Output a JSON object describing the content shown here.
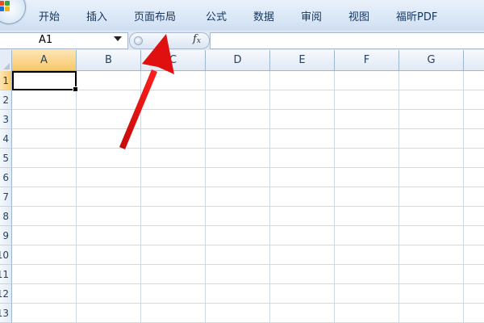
{
  "ribbon": {
    "tabs": [
      {
        "label": "开始"
      },
      {
        "label": "插入"
      },
      {
        "label": "页面布局"
      },
      {
        "label": "公式"
      },
      {
        "label": "数据"
      },
      {
        "label": "审阅"
      },
      {
        "label": "视图"
      },
      {
        "label": "福昕PDF"
      }
    ]
  },
  "formula_bar": {
    "name_box": "A1",
    "fx": "fx",
    "formula": ""
  },
  "sheet": {
    "columns": [
      "A",
      "B",
      "C",
      "D",
      "E",
      "F",
      "G"
    ],
    "selected_column": "A",
    "rows": [
      "1",
      "2",
      "3",
      "4",
      "5",
      "6",
      "7",
      "8",
      "9",
      "10",
      "11",
      "12",
      "13"
    ],
    "selected_row": "1",
    "active_cell": "A1"
  },
  "annotation": {
    "color": "#e01010",
    "points_to": "fx-pill"
  },
  "colors": {
    "ribbon_text": "#15355f",
    "header_selected": "#f8c96b",
    "gridline": "#d0d7e5"
  }
}
